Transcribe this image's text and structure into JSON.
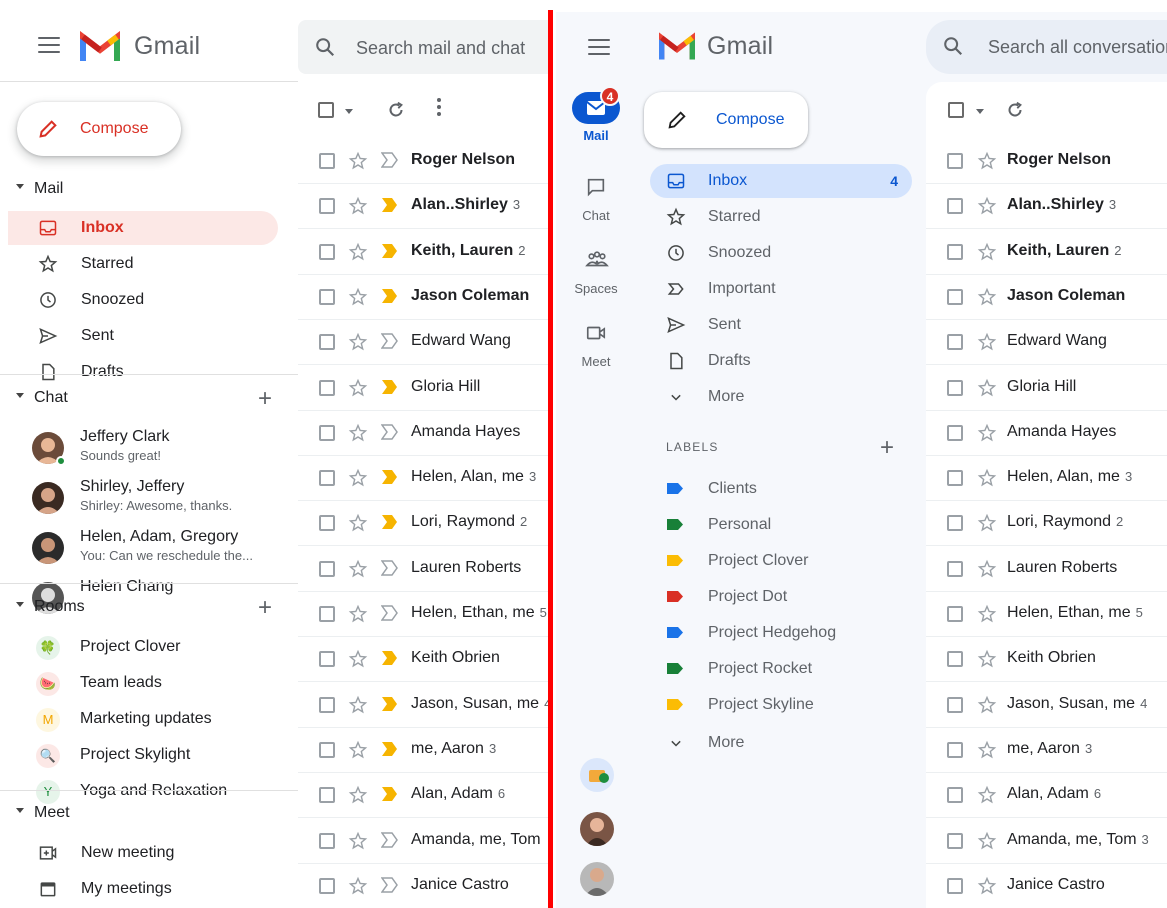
{
  "left": {
    "app_name": "Gmail",
    "search_placeholder": "Search mail and chat",
    "compose_label": "Compose",
    "mail_section": "Mail",
    "mail_items": [
      {
        "label": "Inbox",
        "icon": "inbox-icon",
        "active": true
      },
      {
        "label": "Starred",
        "icon": "star-icon"
      },
      {
        "label": "Snoozed",
        "icon": "clock-icon"
      },
      {
        "label": "Sent",
        "icon": "send-icon"
      },
      {
        "label": "Drafts",
        "icon": "draft-icon"
      }
    ],
    "chat_section": "Chat",
    "chats": [
      {
        "name": "Jeffery Clark",
        "snippet": "Sounds great!"
      },
      {
        "name": "Shirley, Jeffery",
        "snippet": "Shirley: Awesome, thanks."
      },
      {
        "name": "Helen, Adam, Gregory",
        "snippet": "You: Can we reschedule the..."
      },
      {
        "name": "Helen Chang",
        "snippet": ""
      }
    ],
    "rooms_section": "Rooms",
    "rooms": [
      {
        "label": "Project Clover",
        "glyph": "🍀",
        "color": "#e6f4ea"
      },
      {
        "label": "Team leads",
        "glyph": "🍉",
        "color": "#fce8e6"
      },
      {
        "label": "Marketing updates",
        "glyph": "M",
        "color": "#fef7e0"
      },
      {
        "label": "Project Skylight",
        "glyph": "🔍",
        "color": "#fce8e6"
      },
      {
        "label": "Yoga and Relaxation",
        "glyph": "Y",
        "color": "#e6f4ea"
      }
    ],
    "meet_section": "Meet",
    "meet_items": [
      {
        "label": "New meeting",
        "icon": "new-meeting-icon"
      },
      {
        "label": "My meetings",
        "icon": "calendar-icon"
      }
    ]
  },
  "left_emails": [
    {
      "sender": "Roger Nelson",
      "count": "",
      "unread": true,
      "important": false
    },
    {
      "sender": "Alan..Shirley",
      "count": "3",
      "unread": true,
      "important": true
    },
    {
      "sender": "Keith, Lauren",
      "count": "2",
      "unread": true,
      "important": true
    },
    {
      "sender": "Jason Coleman",
      "count": "",
      "unread": true,
      "important": true
    },
    {
      "sender": "Edward Wang",
      "count": "",
      "unread": false,
      "important": false
    },
    {
      "sender": "Gloria Hill",
      "count": "",
      "unread": false,
      "important": true
    },
    {
      "sender": "Amanda Hayes",
      "count": "",
      "unread": false,
      "important": false
    },
    {
      "sender": "Helen, Alan, me",
      "count": "3",
      "unread": false,
      "important": true
    },
    {
      "sender": "Lori, Raymond",
      "count": "2",
      "unread": false,
      "important": true
    },
    {
      "sender": "Lauren Roberts",
      "count": "",
      "unread": false,
      "important": false
    },
    {
      "sender": "Helen, Ethan, me",
      "count": "5",
      "unread": false,
      "important": false
    },
    {
      "sender": "Keith Obrien",
      "count": "",
      "unread": false,
      "important": true
    },
    {
      "sender": "Jason, Susan, me",
      "count": "4",
      "unread": false,
      "important": true
    },
    {
      "sender": "me, Aaron",
      "count": "3",
      "unread": false,
      "important": true
    },
    {
      "sender": "Alan, Adam",
      "count": "6",
      "unread": false,
      "important": true
    },
    {
      "sender": "Amanda, me, Tom",
      "count": "",
      "unread": false,
      "important": false
    },
    {
      "sender": "Janice Castro",
      "count": "",
      "unread": false,
      "important": false
    }
  ],
  "right": {
    "app_name": "Gmail",
    "search_placeholder": "Search all conversations",
    "compose_label": "Compose",
    "rail": [
      {
        "label": "Mail",
        "icon": "mail-icon",
        "active": true,
        "badge": "4"
      },
      {
        "label": "Chat",
        "icon": "chat-icon"
      },
      {
        "label": "Spaces",
        "icon": "spaces-icon"
      },
      {
        "label": "Meet",
        "icon": "meet-icon"
      }
    ],
    "nav_items": [
      {
        "label": "Inbox",
        "icon": "inbox-icon",
        "active": true,
        "count": "4"
      },
      {
        "label": "Starred",
        "icon": "star-icon"
      },
      {
        "label": "Snoozed",
        "icon": "clock-icon"
      },
      {
        "label": "Important",
        "icon": "important-icon"
      },
      {
        "label": "Sent",
        "icon": "send-icon"
      },
      {
        "label": "Drafts",
        "icon": "draft-icon"
      },
      {
        "label": "More",
        "icon": "chevron-down-icon"
      }
    ],
    "labels_heading": "LABELS",
    "labels": [
      {
        "label": "Clients",
        "color": "#1a73e8"
      },
      {
        "label": "Personal",
        "color": "#188038"
      },
      {
        "label": "Project Clover",
        "color": "#fbbc04"
      },
      {
        "label": "Project Dot",
        "color": "#d93025"
      },
      {
        "label": "Project Hedgehog",
        "color": "#1a73e8"
      },
      {
        "label": "Project Rocket",
        "color": "#188038"
      },
      {
        "label": "Project Skyline",
        "color": "#fbbc04"
      }
    ],
    "labels_more": "More"
  },
  "right_emails": [
    {
      "sender": "Roger Nelson",
      "count": "",
      "unread": true
    },
    {
      "sender": "Alan..Shirley",
      "count": "3",
      "unread": true
    },
    {
      "sender": "Keith, Lauren",
      "count": "2",
      "unread": true
    },
    {
      "sender": "Jason Coleman",
      "count": "",
      "unread": true
    },
    {
      "sender": "Edward Wang",
      "count": "",
      "unread": false
    },
    {
      "sender": "Gloria Hill",
      "count": "",
      "unread": false
    },
    {
      "sender": "Amanda Hayes",
      "count": "",
      "unread": false
    },
    {
      "sender": "Helen, Alan, me",
      "count": "3",
      "unread": false
    },
    {
      "sender": "Lori, Raymond",
      "count": "2",
      "unread": false
    },
    {
      "sender": "Lauren Roberts",
      "count": "",
      "unread": false
    },
    {
      "sender": "Helen, Ethan, me",
      "count": "5",
      "unread": false
    },
    {
      "sender": "Keith Obrien",
      "count": "",
      "unread": false
    },
    {
      "sender": "Jason, Susan, me",
      "count": "4",
      "unread": false
    },
    {
      "sender": "me, Aaron",
      "count": "3",
      "unread": false
    },
    {
      "sender": "Alan, Adam",
      "count": "6",
      "unread": false
    },
    {
      "sender": "Amanda, me, Tom",
      "count": "3",
      "unread": false
    },
    {
      "sender": "Janice Castro",
      "count": "",
      "unread": false
    }
  ],
  "colors": {
    "divider_red": "#ff0000",
    "gmail_red": "#d93025",
    "new_accent": "#0b57d0",
    "important_yellow": "#f6b400"
  }
}
